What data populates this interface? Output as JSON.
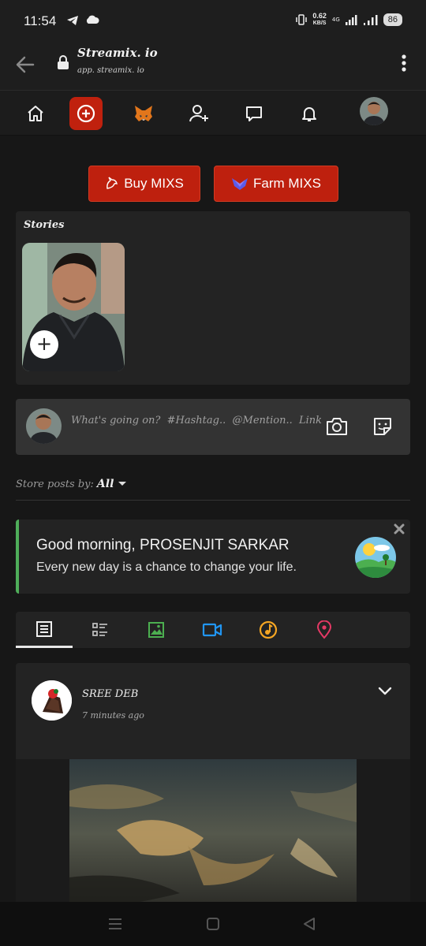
{
  "status_bar": {
    "time": "11:54",
    "speed_value": "0.62",
    "speed_unit": "KB/S",
    "network": "4G",
    "battery": "86"
  },
  "browser": {
    "site_title": "Streamix. io",
    "site_url": "app. streamix. io"
  },
  "actions": {
    "buy_label": "Buy MIXS",
    "farm_label": "Farm MIXS"
  },
  "stories": {
    "title": "Stories",
    "add_symbol": "+"
  },
  "composer": {
    "placeholder": "What's going on?  #Hashtag..  @Mention..  Link.."
  },
  "sort": {
    "label": "Store posts by:",
    "value": "All"
  },
  "greeting": {
    "title": "Good morning, PROSENJIT SARKAR",
    "message": "Every new day is a chance to change your life."
  },
  "post": {
    "author": "SREE DEB",
    "time": "7 minutes ago"
  },
  "colors": {
    "brand_red": "#be200e",
    "greeting_accent": "#4fae5a",
    "tab_images": "#4caf50",
    "tab_video": "#2196f3",
    "tab_music": "#f5a623",
    "tab_location": "#e53965"
  }
}
